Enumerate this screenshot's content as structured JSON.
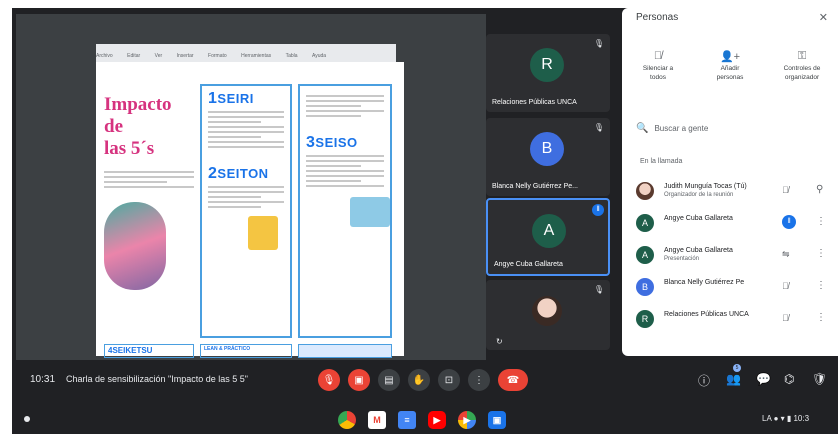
{
  "presentation": {
    "toolbar_items": [
      "Archivo",
      "Editar",
      "Ver",
      "Insertar",
      "Formato",
      "Herramientas",
      "Tabla",
      "Ayuda"
    ],
    "title_line1": "Impacto de",
    "title_line2": "las 5´s",
    "col2_head1_num": "1",
    "col2_head1": "SEIRI",
    "col2_head2_num": "2",
    "col2_head2": "SEITON",
    "col3_head_num": "3",
    "col3_head": "SEISO",
    "bottom1_num": "4",
    "bottom1": "SEIKETSU",
    "bottom2": "LEAN & PRÁCTICO"
  },
  "tiles": [
    {
      "initial": "R",
      "name": "Relaciones Públicas UNCA",
      "color": "#1e5e4a"
    },
    {
      "initial": "B",
      "name": "Blanca Nelly Gutiérrez Pe...",
      "color": "#3f6ee0"
    },
    {
      "initial": "A",
      "name": "Angye Cuba Gallareta",
      "color": "#1e5e4a"
    }
  ],
  "people_panel": {
    "title": "Personas",
    "close_icon": "close-icon",
    "actions": [
      {
        "icon": "mic-off-icon",
        "label1": "Silenciar a",
        "label2": "todos"
      },
      {
        "icon": "person-add-icon",
        "label1": "Añadir",
        "label2": "personas"
      },
      {
        "icon": "key-icon",
        "label1": "Controles de",
        "label2": "organizador"
      }
    ],
    "search_placeholder": "Buscar a gente",
    "section_label": "En la llamada",
    "participants": [
      {
        "initial": "",
        "name": "Judith Munguía Tocas (Tú)",
        "sub": "Organizador de la reunión",
        "color": "#b07060"
      },
      {
        "initial": "A",
        "name": "Angye Cuba Gallareta",
        "sub": "",
        "color": "#1e5e4a"
      },
      {
        "initial": "A",
        "name": "Angye Cuba Gallareta",
        "sub": "Presentación",
        "color": "#1e5e4a"
      },
      {
        "initial": "B",
        "name": "Blanca Nelly Gutiérrez Pe",
        "sub": "",
        "color": "#3f6ee0"
      },
      {
        "initial": "R",
        "name": "Relaciones Públicas UNCA",
        "sub": "",
        "color": "#1e5e4a"
      }
    ]
  },
  "meetbar": {
    "time": "10:31",
    "title": "Charla de sensibilización \"Impacto de las 5 5\"",
    "people_count": "5"
  },
  "shelf": {
    "tray": "LA ● ▾ ▮ 10:3"
  }
}
